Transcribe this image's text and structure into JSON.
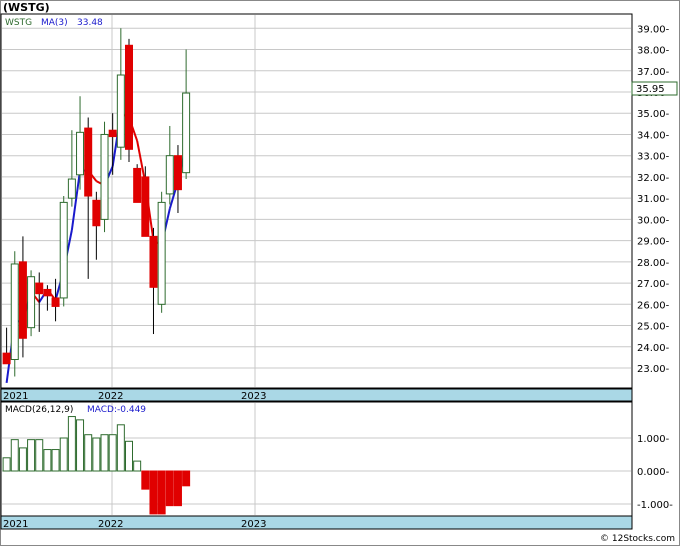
{
  "title": "(WSTG)",
  "watermark": "© 12Stocks.com",
  "price_chart": {
    "legend_symbol": "WSTG",
    "legend_ma_label": "MA(3)",
    "legend_ma_value": "33.48",
    "last_price_label": "35.95",
    "y_ticks": [
      "39.00-",
      "38.00-",
      "37.00-",
      "36.00-",
      "35.00-",
      "34.00-",
      "33.00-",
      "32.00-",
      "31.00-",
      "30.00-",
      "29.00-",
      "28.00-",
      "27.00-",
      "26.00-",
      "25.00-",
      "24.00-",
      "23.00-"
    ],
    "x_labels": [
      "2021",
      "2022",
      "2023"
    ]
  },
  "macd_chart": {
    "legend_label": "MACD(26,12,9)",
    "legend_value_label": "MACD:-0.449",
    "y_ticks": [
      "1.000-",
      "0.000-",
      "-1.000-"
    ],
    "x_labels": [
      "2021",
      "2022",
      "2023"
    ]
  },
  "colors": {
    "up_candle": "#2e6b2e",
    "down_candle": "#e00000",
    "ma_up": "#1a1acc",
    "ma_down": "#e00000",
    "macd_pos": "#2e6b2e",
    "macd_neg": "#e00000",
    "axis_band": "#aad8e6",
    "grid": "#c8c8c8"
  },
  "chart_data": [
    {
      "type": "candlestick",
      "x": [
        "2020-12",
        "2021-01",
        "2021-02",
        "2021-03",
        "2021-04",
        "2021-05",
        "2021-06",
        "2021-07",
        "2021-08",
        "2021-09",
        "2021-10",
        "2021-11",
        "2021-12",
        "2022-01",
        "2022-02",
        "2022-03",
        "2022-04",
        "2022-05",
        "2022-06",
        "2022-07",
        "2022-08",
        "2022-09",
        "2022-10",
        "2022-11",
        "2022-12",
        "2023-01",
        "2023-02",
        "2023-03",
        "2023-04",
        "2023-05",
        "2023-06"
      ],
      "candles": [
        {
          "o": 23.7,
          "h": 24.9,
          "l": 23.3,
          "c": 23.2
        },
        {
          "o": 23.4,
          "h": 28.5,
          "l": 22.6,
          "c": 27.9
        },
        {
          "o": 28.0,
          "h": 29.2,
          "l": 23.5,
          "c": 24.4
        },
        {
          "o": 24.9,
          "h": 27.6,
          "l": 24.5,
          "c": 27.3
        },
        {
          "o": 27.0,
          "h": 27.5,
          "l": 24.7,
          "c": 26.5
        },
        {
          "o": 26.7,
          "h": 26.9,
          "l": 25.7,
          "c": 26.4
        },
        {
          "o": 26.3,
          "h": 27.2,
          "l": 25.2,
          "c": 25.9
        },
        {
          "o": 26.3,
          "h": 31.1,
          "l": 25.9,
          "c": 30.8
        },
        {
          "o": 31.0,
          "h": 34.2,
          "l": 30.6,
          "c": 31.9
        },
        {
          "o": 32.1,
          "h": 35.8,
          "l": 31.4,
          "c": 34.1
        },
        {
          "o": 34.3,
          "h": 34.8,
          "l": 27.2,
          "c": 31.1
        },
        {
          "o": 30.9,
          "h": 31.3,
          "l": 28.1,
          "c": 29.7
        },
        {
          "o": 30.0,
          "h": 34.6,
          "l": 29.4,
          "c": 34.0
        },
        {
          "o": 34.2,
          "h": 35.0,
          "l": 32.1,
          "c": 33.9
        },
        {
          "o": 33.4,
          "h": 39.0,
          "l": 32.8,
          "c": 36.8
        },
        {
          "o": 38.2,
          "h": 38.5,
          "l": 32.7,
          "c": 33.3
        },
        {
          "o": 32.4,
          "h": 32.6,
          "l": 30.8,
          "c": 30.8
        },
        {
          "o": 32.0,
          "h": 32.5,
          "l": 29.2,
          "c": 29.2
        },
        {
          "o": 29.2,
          "h": 29.6,
          "l": 24.6,
          "c": 26.8
        },
        {
          "o": 26.0,
          "h": 31.3,
          "l": 25.6,
          "c": 30.8
        },
        {
          "o": 31.2,
          "h": 34.4,
          "l": 30.7,
          "c": 33.0
        },
        {
          "o": 33.0,
          "h": 33.5,
          "l": 30.3,
          "c": 31.4
        },
        {
          "o": 32.2,
          "h": 38.0,
          "l": 31.9,
          "c": 35.95
        }
      ]
    },
    {
      "type": "line",
      "name": "MA(3)",
      "values": [
        22.3,
        25.2,
        25.2,
        26.6,
        26.1,
        26.7,
        26.2,
        27.6,
        29.5,
        32.3,
        32.3,
        31.8,
        31.6,
        32.5,
        35.0,
        34.8,
        33.7,
        31.7,
        29.0,
        28.8,
        30.5,
        31.8,
        33.48
      ]
    },
    {
      "type": "bar",
      "name": "MACD(26,12,9)",
      "values": [
        0.4,
        0.95,
        0.7,
        0.95,
        0.95,
        0.65,
        0.65,
        1.0,
        1.65,
        1.55,
        1.1,
        1.0,
        1.1,
        1.1,
        1.4,
        0.9,
        0.3,
        -0.55,
        -1.3,
        -1.3,
        -1.05,
        -1.05,
        -0.449
      ],
      "ylim": [
        -1.35,
        2.0
      ]
    }
  ]
}
